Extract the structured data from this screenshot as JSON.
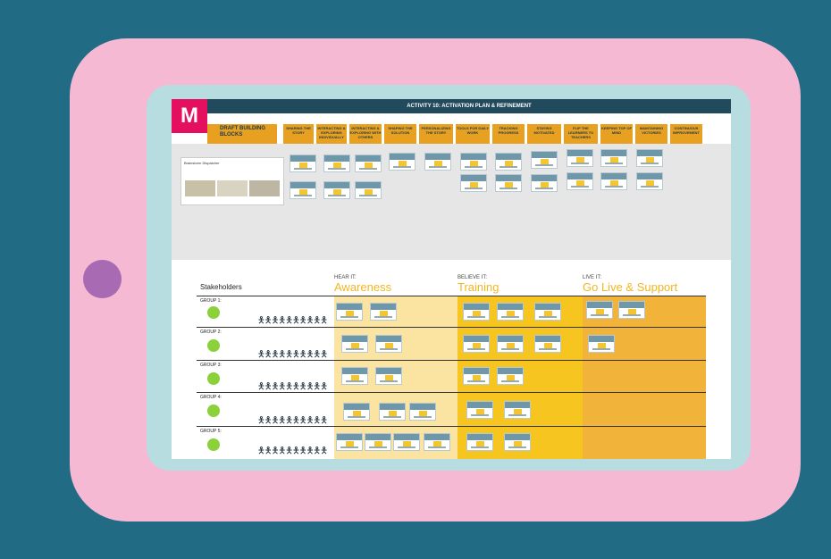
{
  "app": {
    "logo": "M",
    "title": "ACTIVITY 10: ACTIVATION PLAN & REFINEMENT"
  },
  "columns": [
    "DRAFT BUILDING BLOCKS",
    "SHARING THE STORY",
    "INTERACTING & EXPLORING INDIVIDUALLY",
    "INTERACTING & EXPLORING WITH OTHERS",
    "SHAPING THE SOLUTION",
    "PERSONALIZING THE STORY",
    "TOOLS FOR DAILY WORK",
    "TRACKING PROGRESS",
    "STAYING MOTIVATED",
    "FLIP THE LEARNERS TO TEACHERS",
    "KEEPING TOP OF MIND",
    "MAINTAINING VICTORIES",
    "CONTINUOUS IMPROVEMENT"
  ],
  "photo_card_title": "Brainstorm Dispatcher",
  "plan": {
    "stakeholders_label": "Stakeholders",
    "phases": [
      {
        "small": "HEAR IT:",
        "big": "Awareness"
      },
      {
        "small": "BELIEVE IT:",
        "big": "Training"
      },
      {
        "small": "LIVE IT:",
        "big": "Go Live & Support"
      }
    ],
    "groups": [
      "GROUP 1:",
      "GROUP 2:",
      "GROUP 3:",
      "GROUP 4:",
      "GROUP 5:"
    ],
    "people": "🯅🯅🯅🯅🯅🯅🯅🯅🯅🯅"
  },
  "colors": {
    "background": "#226b85",
    "tablet": "#f5b9d3",
    "bezel": "#b7dde0",
    "header": "#214a5c",
    "column": "#e8a020",
    "awareness": "#fbe3a1",
    "training": "#f7c51f",
    "support": "#f2b33a",
    "logo": "#e4105f"
  }
}
